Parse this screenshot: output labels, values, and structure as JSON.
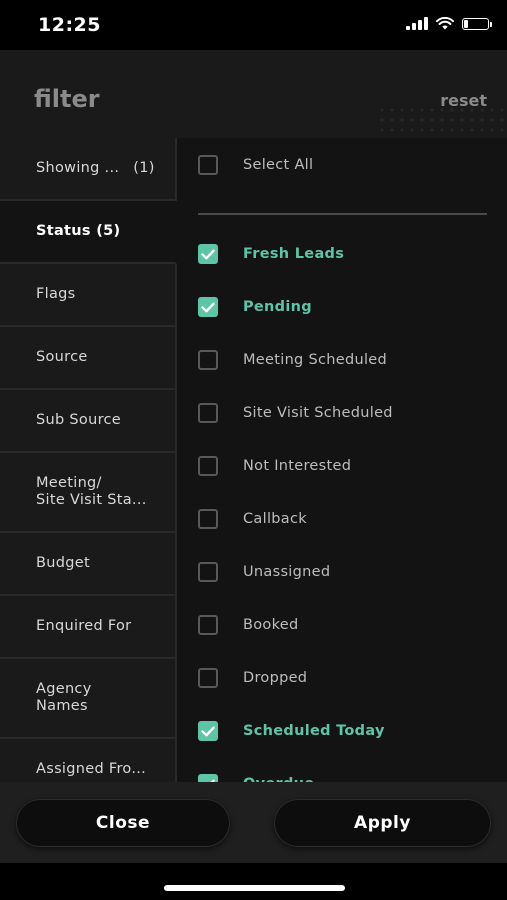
{
  "status_bar": {
    "time": "12:25"
  },
  "header": {
    "title": "filter",
    "reset_label": "reset"
  },
  "sidebar": {
    "items": [
      {
        "label": "Showing ...",
        "count": "(1)"
      },
      {
        "label": "Status (5)",
        "count": ""
      },
      {
        "label": "Flags",
        "count": ""
      },
      {
        "label": "Source",
        "count": ""
      },
      {
        "label": "Sub Source",
        "count": ""
      },
      {
        "label": "Meeting/",
        "label2": "Site Visit Sta...",
        "count": ""
      },
      {
        "label": "Budget",
        "count": ""
      },
      {
        "label": "Enquired For",
        "count": ""
      },
      {
        "label": "Agency",
        "label2": "Names",
        "count": ""
      },
      {
        "label": "Assigned Fro...",
        "count": ""
      }
    ],
    "active_index": 1
  },
  "options": {
    "select_all": {
      "label": "Select All",
      "checked": false
    },
    "items": [
      {
        "label": "Fresh Leads",
        "checked": true
      },
      {
        "label": "Pending",
        "checked": true
      },
      {
        "label": "Meeting Scheduled",
        "checked": false
      },
      {
        "label": "Site Visit Scheduled",
        "checked": false
      },
      {
        "label": "Not Interested",
        "checked": false
      },
      {
        "label": "Callback",
        "checked": false
      },
      {
        "label": "Unassigned",
        "checked": false
      },
      {
        "label": "Booked",
        "checked": false
      },
      {
        "label": "Dropped",
        "checked": false
      },
      {
        "label": "Scheduled Today",
        "checked": true
      },
      {
        "label": "Overdue",
        "checked": true
      }
    ]
  },
  "footer": {
    "close_label": "Close",
    "apply_label": "Apply"
  },
  "colors": {
    "accent": "#5fc3a6",
    "background": "#131313",
    "panel": "#1a1a1a"
  }
}
